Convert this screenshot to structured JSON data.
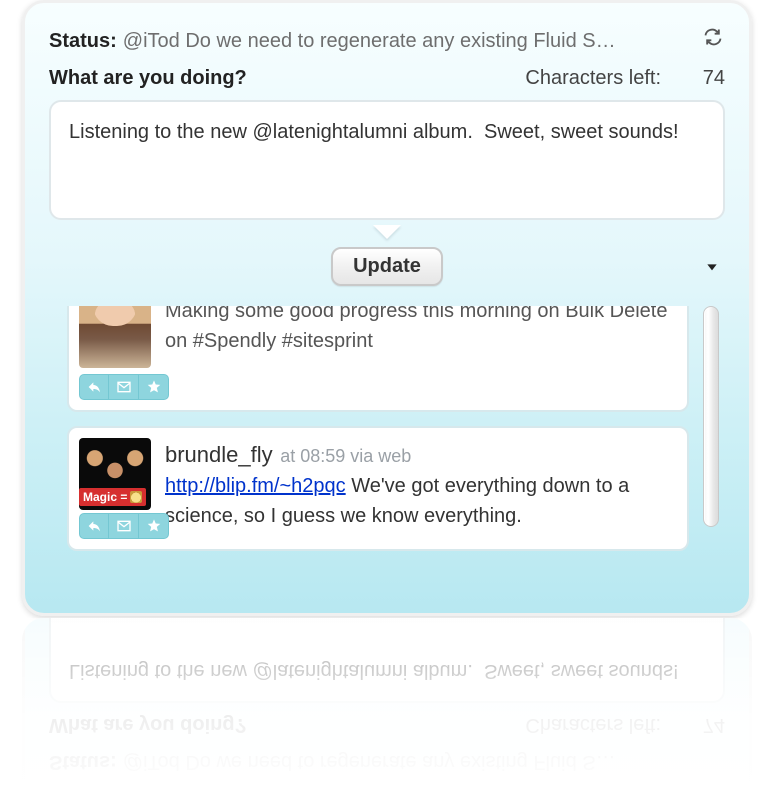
{
  "status": {
    "label": "Status:",
    "text": "@iTod Do we need to regenerate any existing Fluid S…"
  },
  "compose": {
    "prompt": "What are you doing?",
    "chars_label": "Characters left:",
    "chars_left": "74",
    "text": "Listening to the new @latenightalumni album.  Sweet, sweet sounds!",
    "update_label": "Update"
  },
  "tweets": [
    {
      "username": "",
      "meta": "",
      "text_pre": "Making some good progress this morning on Bulk Delete on #Spendly #sitesprint",
      "badge": ""
    },
    {
      "username": "brundle_fly",
      "meta": "at 08:59 via web",
      "link_text": "http://blip.fm/~h2pqc",
      "text_post": " We've got everything down to a science, so I guess we know everything.",
      "badge": "Magic ="
    }
  ]
}
